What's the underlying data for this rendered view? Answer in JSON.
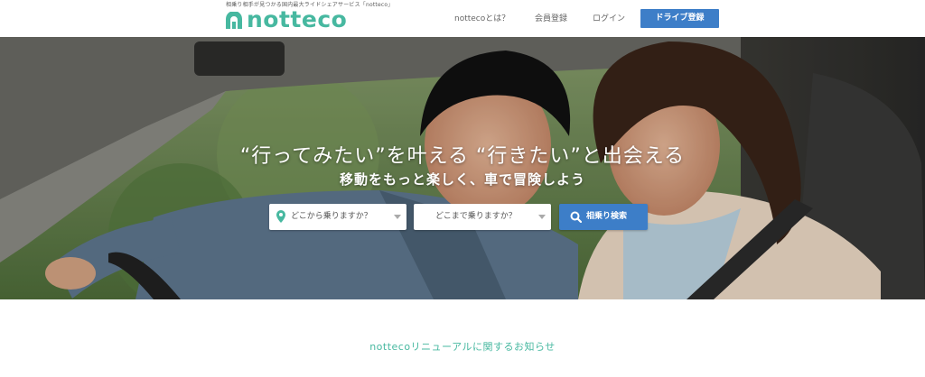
{
  "header": {
    "tagline": "相乗り相手が見つかる国内最大ライドシェアサービス「notteco」",
    "logo_text": "notteco",
    "nav": {
      "about": "nottecoとは？",
      "register": "会員登録",
      "login": "ログイン"
    },
    "drive_button": "ドライブ登録"
  },
  "hero": {
    "headline": "“行ってみたい”を叶える “行きたい”と出会える",
    "subline": "移動をもっと楽しく、車で冒険しよう",
    "from_select": "どこから乗りますか？",
    "to_select": "どこまで乗りますか？",
    "search_button": "相乗り検索"
  },
  "notice": "nottecoリニューアルに関するお知らせ",
  "colors": {
    "brand_green": "#47b8a0",
    "accent_blue": "#3d7ec8"
  },
  "icons": [
    "logo-mark-icon",
    "location-pin-icon",
    "chevron-down-icon",
    "search-icon"
  ]
}
